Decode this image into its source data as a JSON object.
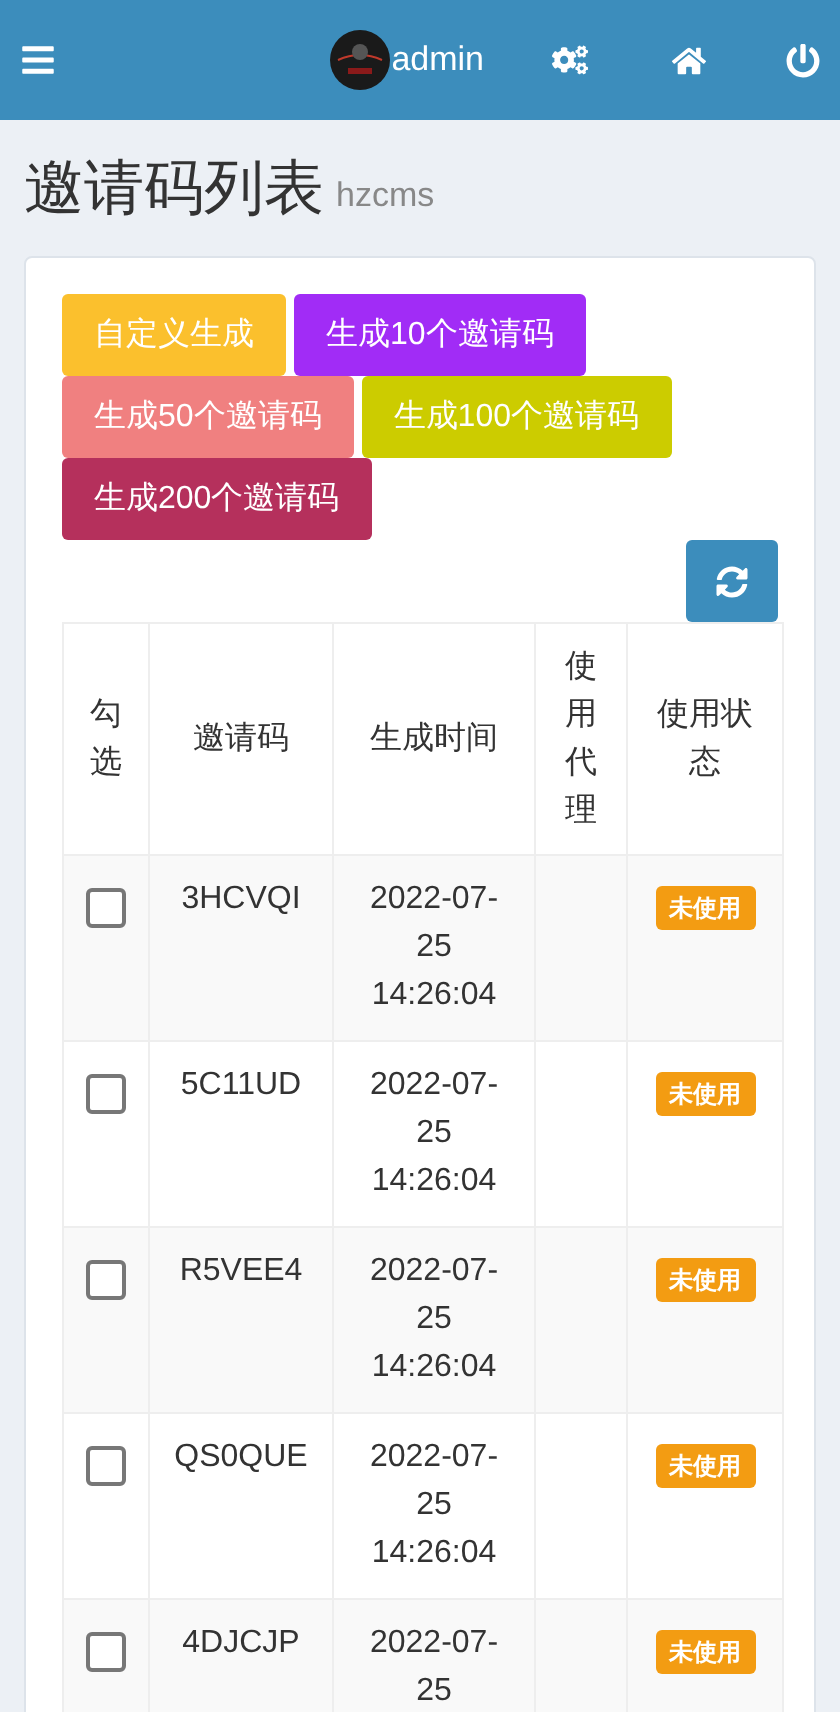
{
  "navbar": {
    "username": "admin"
  },
  "page": {
    "title": "邀请码列表",
    "subtitle": "hzcms"
  },
  "actions": [
    {
      "label": "自定义生成",
      "color": "#fbc02d"
    },
    {
      "label": "生成10个邀请码",
      "color": "#a12cf6"
    },
    {
      "label": "生成50个邀请码",
      "color": "#f08080"
    },
    {
      "label": "生成100个邀请码",
      "color": "#cccc00"
    },
    {
      "label": "生成200个邀请码",
      "color": "#b5305c"
    }
  ],
  "table": {
    "columns": [
      "勾选",
      "邀请码",
      "生成时间",
      "使用代理",
      "使用状态"
    ],
    "rows": [
      {
        "checked": false,
        "code": "3HCVQI",
        "time": "2022-07-25 14:26:04",
        "status": "未使用"
      },
      {
        "checked": false,
        "code": "5C11UD",
        "time": "2022-07-25 14:26:04",
        "status": "未使用"
      },
      {
        "checked": false,
        "code": "R5VEE4",
        "time": "2022-07-25 14:26:04",
        "status": "未使用"
      },
      {
        "checked": false,
        "code": "QS0QUE",
        "time": "2022-07-25 14:26:04",
        "status": "未使用"
      },
      {
        "checked": false,
        "code": "4DJCJP",
        "time": "2022-07-25",
        "status": "未使用"
      }
    ]
  }
}
